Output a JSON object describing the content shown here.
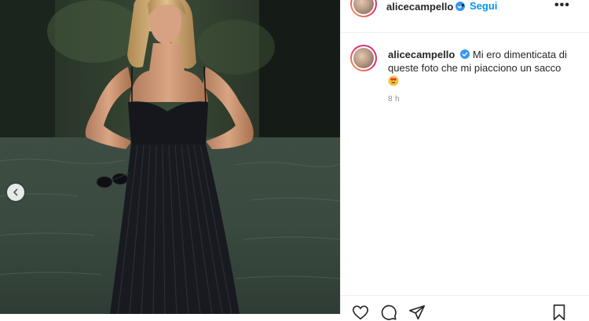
{
  "post": {
    "username": "alicecampello",
    "follow_label": "Segui",
    "separator": "•",
    "more_label": "•••",
    "caption": "Mi ero dimenticata di queste foto che mi piacciono un sacco",
    "time_ago": "8 h"
  },
  "icons": {
    "verified": "verified-badge-icon",
    "prev": "chevron-left-icon",
    "like": "heart-icon",
    "comment": "comment-icon",
    "share": "paper-plane-icon",
    "save": "bookmark-icon",
    "emoji": "heart-eyes-emoji"
  },
  "colors": {
    "accent": "#0095f6",
    "text": "#262626",
    "muted": "#8e8e8e",
    "border": "#efefef"
  }
}
